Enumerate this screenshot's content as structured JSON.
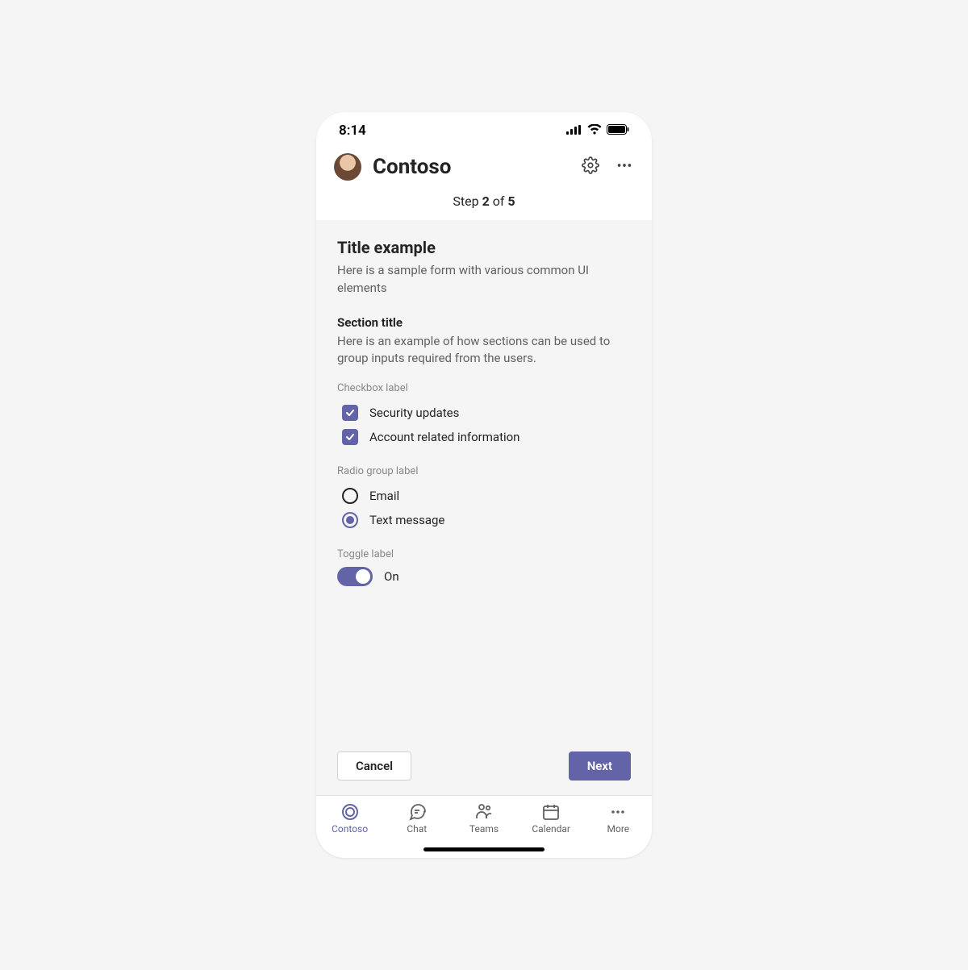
{
  "status": {
    "time": "8:14"
  },
  "header": {
    "app_name": "Contoso"
  },
  "step": {
    "prefix": "Step ",
    "current": "2",
    "of": " of ",
    "total": "5"
  },
  "form": {
    "title": "Title example",
    "title_desc": "Here is a sample form with various common UI elements",
    "section_title": "Section title",
    "section_desc": "Here is an example of how sections can be used to group inputs required from the users.",
    "checkbox_group_label": "Checkbox label",
    "checkboxes": [
      {
        "label": "Security updates",
        "checked": true
      },
      {
        "label": "Account related information",
        "checked": true
      }
    ],
    "radio_group_label": "Radio group label",
    "radios": [
      {
        "label": "Email",
        "selected": false
      },
      {
        "label": "Text message",
        "selected": true
      }
    ],
    "toggle_group_label": "Toggle label",
    "toggle": {
      "on": true,
      "label": "On"
    }
  },
  "buttons": {
    "cancel": "Cancel",
    "next": "Next"
  },
  "nav": {
    "items": [
      {
        "label": "Contoso",
        "active": true
      },
      {
        "label": "Chat",
        "active": false
      },
      {
        "label": "Teams",
        "active": false
      },
      {
        "label": "Calendar",
        "active": false
      },
      {
        "label": "More",
        "active": false
      }
    ]
  },
  "colors": {
    "accent": "#6264A7"
  }
}
